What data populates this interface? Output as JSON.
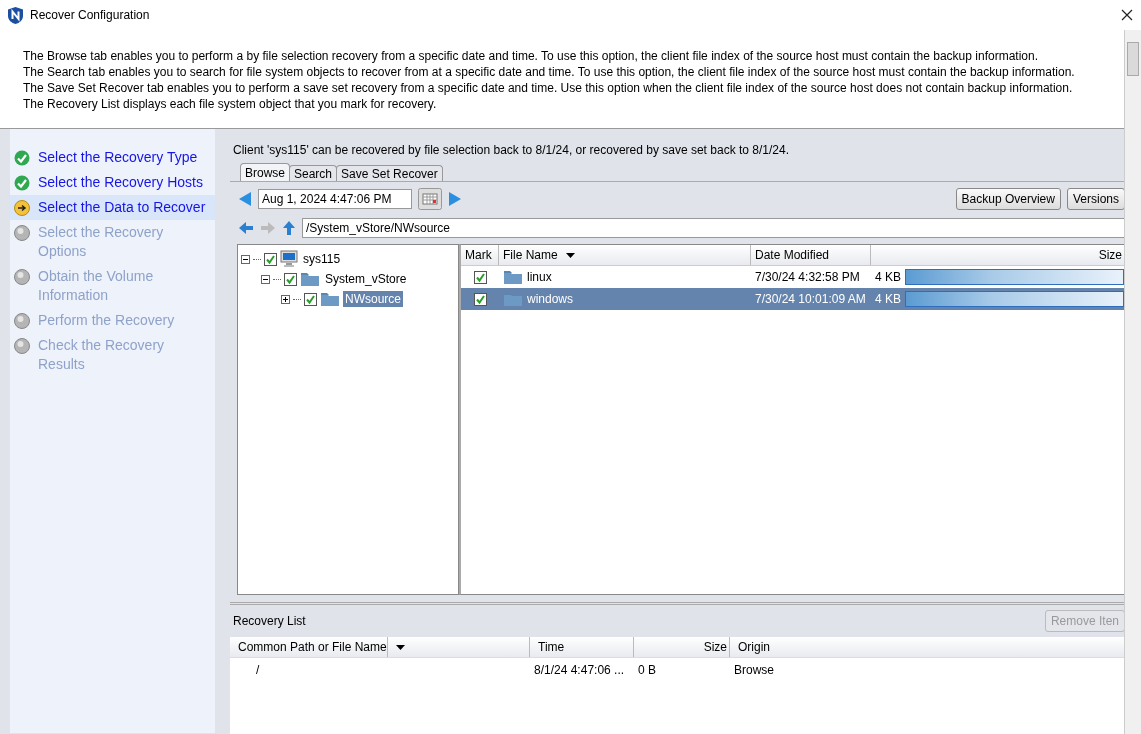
{
  "window": {
    "title": "Recover Configuration"
  },
  "description": [
    "The Browse tab enables you to perform a by file selection recovery from a specific date and time. To use this option, the client file index of the source host must contain the backup information.",
    "The Search tab enables you to search for file system objects to recover from at a specific date and time. To use this option, the client file index of the source host must contain the backup information.",
    "The Save Set Recover tab enables you to perform a save set recovery from a specific date and time.  Use this option when the client file index of the source host does not contain backup information.",
    "The Recovery List displays each file system object that you mark for recovery."
  ],
  "steps": [
    {
      "label": "Select the Recovery Type",
      "kind": "done",
      "selected": false
    },
    {
      "label": "Select the Recovery Hosts",
      "kind": "done",
      "selected": false
    },
    {
      "label": "Select the Data to Recover",
      "kind": "current",
      "selected": true
    },
    {
      "label": "Select the Recovery Options",
      "kind": "pending",
      "selected": false
    },
    {
      "label": "Obtain the Volume Information",
      "kind": "pending",
      "selected": false
    },
    {
      "label": "Perform the Recovery",
      "kind": "pending",
      "selected": false
    },
    {
      "label": "Check the Recovery Results",
      "kind": "pending",
      "selected": false
    }
  ],
  "client_info": "Client 'sys115' can be recovered by file selection back to 8/1/24, or recovered by save set back to 8/1/24.",
  "tabs": [
    {
      "label": "Browse",
      "selected": true
    },
    {
      "label": "Search",
      "selected": false
    },
    {
      "label": "Save Set Recover",
      "selected": false
    }
  ],
  "date_field": {
    "value": "Aug 1, 2024 4:47:06 PM"
  },
  "buttons": [
    "Backup Overview",
    "Versions"
  ],
  "path_field": {
    "value": "/System_vStore/NWsource"
  },
  "tree": [
    {
      "label": "sys115",
      "kind": "host",
      "checked": true,
      "expanded": true,
      "selected": false,
      "children": [
        {
          "label": "System_vStore",
          "kind": "folder",
          "checked": true,
          "expanded": true,
          "selected": false,
          "children": [
            {
              "label": "NWsource",
              "kind": "folder",
              "checked": true,
              "expanded": false,
              "selected": true
            }
          ]
        }
      ]
    }
  ],
  "files": {
    "columns": [
      "Mark",
      "File Name",
      "Date Modified",
      "Size"
    ],
    "rows": [
      {
        "checked": true,
        "selected": false,
        "name": "linux",
        "modified": "7/30/24 4:32:58 PM",
        "size": "4 KB"
      },
      {
        "checked": true,
        "selected": true,
        "name": "windows",
        "modified": "7/30/24 10:01:09 AM",
        "size": "4 KB"
      }
    ]
  },
  "recovery_list": {
    "title": "Recovery List",
    "remove_button": {
      "label": "Remove Iten",
      "disabled": true
    },
    "columns": [
      "Common Path or File Name",
      "Time",
      "Size",
      "Origin"
    ],
    "rows": [
      {
        "path": "/",
        "time": "8/1/24 4:47:06 ...",
        "size": "0 B",
        "origin": "Browse"
      }
    ]
  }
}
